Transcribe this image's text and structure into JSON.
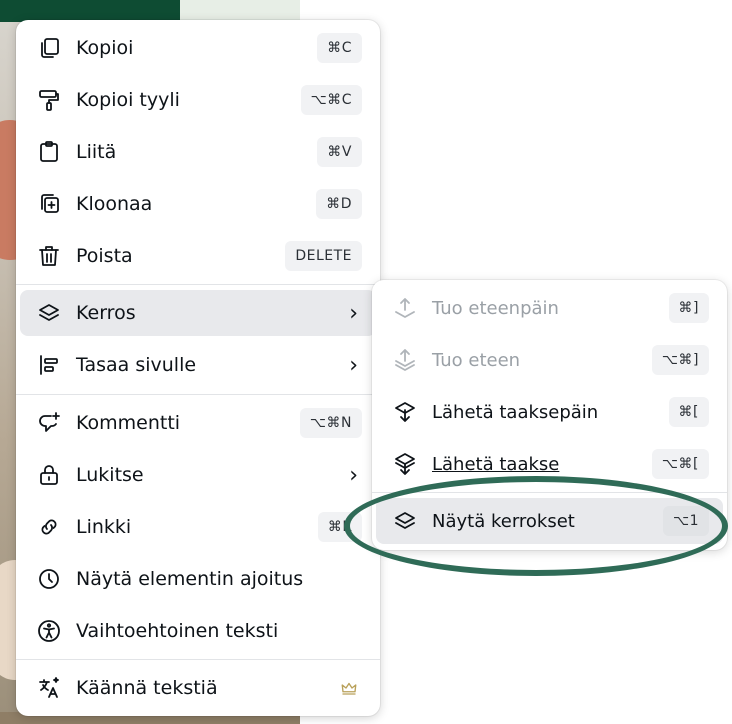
{
  "menu": {
    "items": [
      {
        "label": "Kopioi",
        "shortcut": "⌘C"
      },
      {
        "label": "Kopioi tyyli",
        "shortcut": "⌥⌘C"
      },
      {
        "label": "Liitä",
        "shortcut": "⌘V"
      },
      {
        "label": "Kloonaa",
        "shortcut": "⌘D"
      },
      {
        "label": "Poista",
        "shortcut": "DELETE"
      },
      {
        "label": "Kerros"
      },
      {
        "label": "Tasaa sivulle"
      },
      {
        "label": "Kommentti",
        "shortcut": "⌥⌘N"
      },
      {
        "label": "Lukitse"
      },
      {
        "label": "Linkki",
        "shortcut": "⌘K"
      },
      {
        "label": "Näytä elementin ajoitus"
      },
      {
        "label": "Vaihtoehtoinen teksti"
      },
      {
        "label": "Käännä tekstiä"
      }
    ],
    "chevron": "›"
  },
  "submenu": {
    "items": [
      {
        "label": "Tuo eteenpäin",
        "shortcut": "⌘]"
      },
      {
        "label": "Tuo eteen",
        "shortcut": "⌥⌘]"
      },
      {
        "label": "Lähetä taaksepäin",
        "shortcut": "⌘["
      },
      {
        "label": "Lähetä taakse",
        "shortcut": "⌥⌘["
      },
      {
        "label": "Näytä kerrokset",
        "shortcut": "⌥1"
      }
    ]
  },
  "colors": {
    "highlight_ring": "#2f6b57",
    "active_bg": "#e8e9ec",
    "shortcut_bg": "#f1f2f4",
    "disabled_text": "#9aa0a6"
  }
}
